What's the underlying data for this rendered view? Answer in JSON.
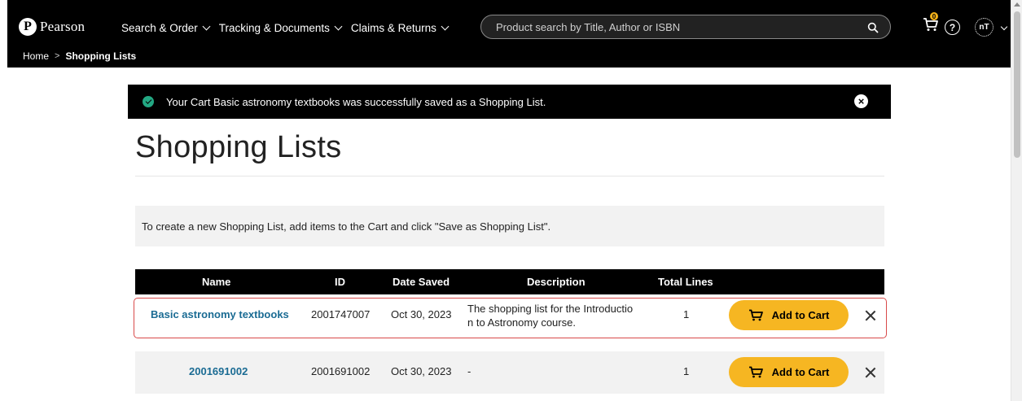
{
  "header": {
    "logo_text": "Pearson",
    "nav": [
      {
        "label": "Search & Order"
      },
      {
        "label": "Tracking & Documents"
      },
      {
        "label": "Claims & Returns"
      }
    ],
    "search": {
      "placeholder": "Product search by Title, Author or ISBN"
    },
    "cart_count": "0",
    "help_symbol": "?",
    "avatar_initials": "nT",
    "icons": [
      "pearson-logo",
      "chevron-down-icon",
      "search-icon",
      "cart-icon",
      "help-icon",
      "avatar"
    ]
  },
  "breadcrumb": {
    "home": "Home",
    "separator": ">",
    "current": "Shopping Lists"
  },
  "banner": {
    "message": "Your Cart Basic astronomy textbooks was successfully saved as a Shopping List."
  },
  "page": {
    "title": "Shopping Lists",
    "info": "To create a new Shopping List, add items to the Cart and click \"Save as Shopping List\"."
  },
  "table": {
    "columns": {
      "name": "Name",
      "id": "ID",
      "date_saved": "Date Saved",
      "description": "Description",
      "total_lines": "Total Lines"
    },
    "rows": [
      {
        "name": "Basic astronomy textbooks",
        "id": "2001747007",
        "date_saved": "Oct 30, 2023",
        "description_line1": "The shopping list for the Introductio",
        "description_line2": "n to Astronomy course.",
        "total_lines": "1",
        "add_label": "Add to Cart"
      },
      {
        "name": "2001691002",
        "id": "2001691002",
        "date_saved": "Oct 30, 2023",
        "description_line1": "-",
        "description_line2": "",
        "total_lines": "1",
        "add_label": "Add to Cart"
      }
    ]
  },
  "colors": {
    "accent": "#f6b622",
    "link": "#1a6b93",
    "success": "#23a883",
    "highlight": "#d94a4a"
  }
}
